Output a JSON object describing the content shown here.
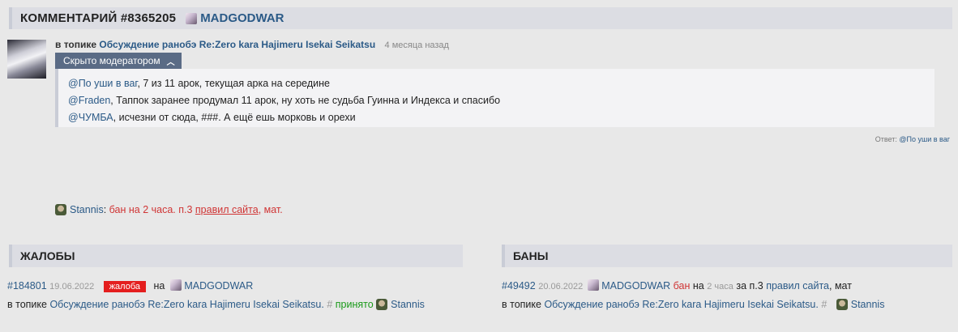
{
  "header": {
    "title": "КОММЕНТАРИЙ #8365205",
    "user": "MADGODWAR"
  },
  "comment": {
    "in_topic_label": "в топике",
    "topic": "Обсуждение ранобэ Re:Zero kara Hajimeru Isekai Seikatsu",
    "ago": "4 месяца назад",
    "moderated_label": "Скрыто модератором",
    "lines": [
      {
        "mention": "@По уши в ваг",
        "text": ", 7 из 11 арок, текущая арка на середине"
      },
      {
        "mention": "@Fraden",
        "text": ", Таппок заранее продумал 11 арок, ну хоть не судьба Гуинна и Индекса и спасибо"
      },
      {
        "mention": "@ЧУМБА",
        "text": ", исчезни от сюда, ###. А ещё ешь морковь и орехи"
      }
    ],
    "reply_label": "Ответ:",
    "reply_to": "@По уши в ваг"
  },
  "ban_notice": {
    "moderator": "Stannis",
    "colon": ":",
    "text_before": " бан на 2 часа. п.3 ",
    "rules_link": "правил сайта",
    "text_after": ", мат."
  },
  "complaints": {
    "title": "ЖАЛОБЫ",
    "id": "#184801",
    "date": "19.06.2022",
    "tag": "жалоба",
    "on_label": "на",
    "user": "MADGODWAR",
    "in_topic_label": "в топике",
    "topic": "Обсуждение ранобэ Re:Zero kara Hajimeru Isekai Seikatsu.",
    "hash": "#",
    "status": "принято",
    "moderator": "Stannis"
  },
  "bans": {
    "title": "БАНЫ",
    "id": "#49492",
    "date": "20.06.2022",
    "user": "MADGODWAR",
    "ban_word": "бан",
    "on_label": "на",
    "duration": "2 часа",
    "for_label": "за п.3",
    "rules": "правил сайта",
    "reason": ", мат",
    "in_topic_label": "в топике",
    "topic": "Обсуждение ранобэ Re:Zero kara Hajimeru Isekai Seikatsu.",
    "hash": "#",
    "moderator": "Stannis"
  },
  "colors": {
    "link": "#2b5a87",
    "danger": "#e41e1e",
    "success": "#1a9a1a",
    "moderator_tag": "#5a6b85"
  }
}
